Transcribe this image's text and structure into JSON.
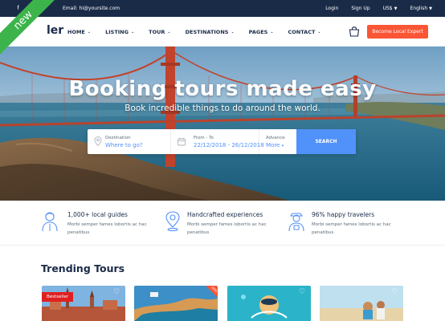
{
  "topbar": {
    "social": [
      "f",
      "t"
    ],
    "email_label": "Email: hi@yoursite.com",
    "links": [
      "Login",
      "Sign Up",
      "US$",
      "English"
    ]
  },
  "header": {
    "logo_text": "ler",
    "nav": [
      "HOME",
      "LISTING",
      "TOUR",
      "DESTINATIONS",
      "PAGES",
      "CONTACT"
    ],
    "cta": "Become Local Expert"
  },
  "ribbon": "new",
  "hero": {
    "title": "Booking tours made easy",
    "subtitle": "Book incredible things to do around the world."
  },
  "search": {
    "destination_label": "Destination",
    "destination_value": "Where to go?",
    "date_label": "From - To",
    "date_value": "22/12/2018 - 26/12/2018",
    "advance_label": "Advance",
    "advance_value": "More",
    "button": "SEARCH"
  },
  "features": [
    {
      "title": "1,000+ local guides",
      "desc": "Morbi semper fames lobortis ac hac penatibus"
    },
    {
      "title": "Handcrafted experiences",
      "desc": "Morbi semper fames lobortis ac hac penatibus"
    },
    {
      "title": "96% happy travelers",
      "desc": "Morbi semper fames lobortis ac hac penatibus"
    }
  ],
  "trending": {
    "title": "Trending Tours",
    "badge": "Bestseller",
    "corner_badge": "20%"
  },
  "colors": {
    "navy": "#1a2b48",
    "accent_orange": "#fa5636",
    "accent_blue": "#5191fa",
    "ribbon_green": "#3cb44b"
  }
}
